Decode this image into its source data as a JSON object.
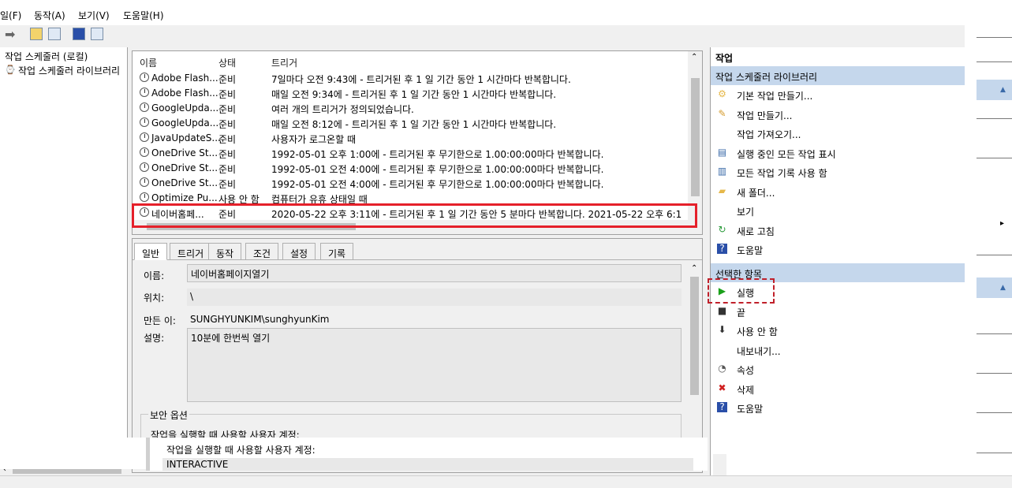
{
  "menu": [
    "일(F)",
    "동작(A)",
    "보기(V)",
    "도움말(H)"
  ],
  "tree": {
    "root": "작업 스케줄러 (로컬)",
    "child": "작업 스케줄러 라이브러리"
  },
  "list": {
    "columns": [
      "이름",
      "상태",
      "트리거"
    ],
    "rows": [
      {
        "name": "Adobe Flash...",
        "status": "준비",
        "trigger": "7일마다 오전 9:43에 - 트리거된 후 1 일 기간 동안 1 시간마다 반복합니다."
      },
      {
        "name": "Adobe Flash...",
        "status": "준비",
        "trigger": "매일 오전 9:34에 - 트리거된 후 1 일 기간 동안 1 시간마다 반복합니다."
      },
      {
        "name": "GoogleUpda...",
        "status": "준비",
        "trigger": "여러 개의 트리거가 정의되었습니다."
      },
      {
        "name": "GoogleUpda...",
        "status": "준비",
        "trigger": "매일 오전 8:12에 - 트리거된 후 1 일 기간 동안 1 시간마다 반복합니다."
      },
      {
        "name": "JavaUpdateS...",
        "status": "준비",
        "trigger": "사용자가 로그온할 때"
      },
      {
        "name": "OneDrive St...",
        "status": "준비",
        "trigger": "1992-05-01 오후 1:00에 - 트리거된 후 무기한으로 1.00:00:00마다 반복합니다."
      },
      {
        "name": "OneDrive St...",
        "status": "준비",
        "trigger": "1992-05-01 오전 4:00에 - 트리거된 후 무기한으로 1.00:00:00마다 반복합니다."
      },
      {
        "name": "OneDrive St...",
        "status": "준비",
        "trigger": "1992-05-01 오전 4:00에 - 트리거된 후 무기한으로 1.00:00:00마다 반복합니다."
      },
      {
        "name": "Optimize Pu...",
        "status": "사용 안 함",
        "trigger": "컴퓨터가 유휴 상태일 때"
      },
      {
        "name": "네이버홈페...",
        "status": "준비",
        "trigger": "2020-05-22 오후 3:11에 - 트리거된 후 1 일 기간 동안 5 분마다 반복합니다. 2021-05-22 오후 6:1"
      }
    ]
  },
  "detail": {
    "tabs": [
      "일반",
      "트리거",
      "동작",
      "조건",
      "설정",
      "기록"
    ],
    "name_label": "이름:",
    "name_value": "네이버홈페이지열기",
    "location_label": "위치:",
    "location_value": "\\",
    "author_label": "만든 이:",
    "author_value": "SUNGHYUNKIM\\sunghyunKim",
    "desc_label": "설명:",
    "desc_value": "10분에 한번씩 열기",
    "security_title": "보안 옵션",
    "security_account_label": "작업을 실행할 때 사용할 사용자 계정:",
    "overlay_account_label": "작업을 실행할 때 사용할 사용자 계정:",
    "overlay_account_value": "INTERACTIVE"
  },
  "actions": {
    "header": "작업",
    "section1": "작업 스케줄러 라이브러리",
    "items1": [
      "기본 작업 만들기...",
      "작업 만들기...",
      "작업 가져오기...",
      "실행 중인 모든 작업 표시",
      "모든 작업 기록 사용 함",
      "새 폴더...",
      "보기",
      "새로 고침",
      "도움말"
    ],
    "section2": "선택한 항목",
    "items2": [
      "실행",
      "끝",
      "사용 안 함",
      "내보내기...",
      "속성",
      "삭제",
      "도움말"
    ]
  },
  "colors": {
    "selection_border": "#e5202a",
    "section_header": "#c5d7ec"
  }
}
